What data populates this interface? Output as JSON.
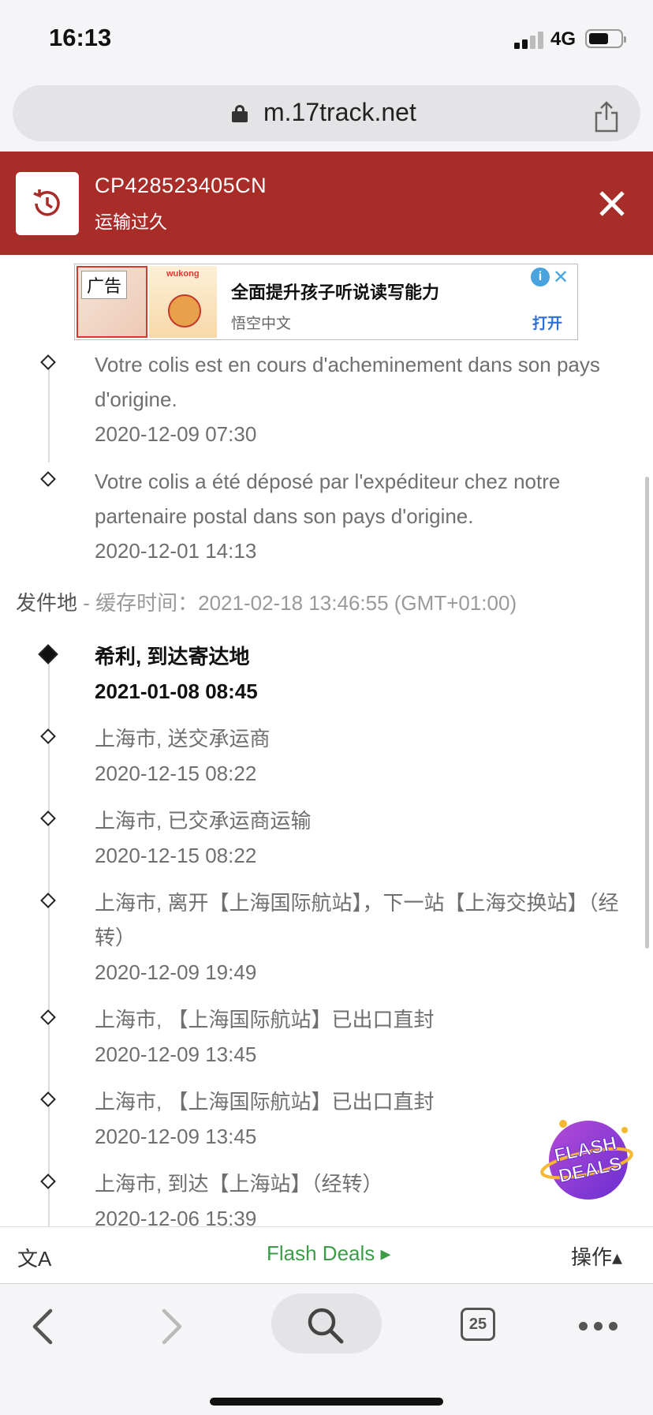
{
  "status_bar": {
    "time": "16:13",
    "network": "4G",
    "battery_level": 0.6
  },
  "browser": {
    "url": "m.17track.net"
  },
  "tracking_header": {
    "tracking_number": "CP428523405CN",
    "status": "运输过久",
    "accent_color": "#a82c28"
  },
  "ad": {
    "label": "广告",
    "brand": "wukong",
    "title": "全面提升孩子听说读写能力",
    "advertiser": "悟空中文",
    "cta": "打开"
  },
  "destination_events": [
    {
      "description": "Votre colis est en cours d'acheminement dans son pays d'origine.",
      "datetime": "2020-12-09 07:30"
    },
    {
      "description": "Votre colis a été déposé par l'expéditeur chez notre partenaire postal dans son pays d'origine.",
      "datetime": "2020-12-01 14:13"
    }
  ],
  "origin_section": {
    "title": "发件地",
    "cache_label": " - 缓存时间：",
    "cache_time": "2021-02-18 13:46:55 (GMT+01:00)"
  },
  "origin_events": [
    {
      "description": "希利, 到达寄达地",
      "datetime": "2021-01-08 08:45",
      "latest": true
    },
    {
      "description": "上海市, 送交承运商",
      "datetime": "2020-12-15 08:22"
    },
    {
      "description": "上海市, 已交承运商运输",
      "datetime": "2020-12-15 08:22"
    },
    {
      "description": "上海市, 离开【上海国际航站】，下一站【上海交换站】（经转）",
      "datetime": "2020-12-09 19:49"
    },
    {
      "description": "上海市, 【上海国际航站】已出口直封",
      "datetime": "2020-12-09 13:45"
    },
    {
      "description": "上海市, 【上海国际航站】已出口直封",
      "datetime": "2020-12-09 13:45"
    },
    {
      "description": "上海市, 到达【上海站】（经转）",
      "datetime": "2020-12-06 15:39"
    }
  ],
  "flash_badge": {
    "line1": "FLASH",
    "line2": "DEALS"
  },
  "page_bar": {
    "translate_icon": "文A",
    "flash_deals": "Flash Deals ▸",
    "operations": "操作▴"
  },
  "safari_bar": {
    "tab_count": "25"
  }
}
